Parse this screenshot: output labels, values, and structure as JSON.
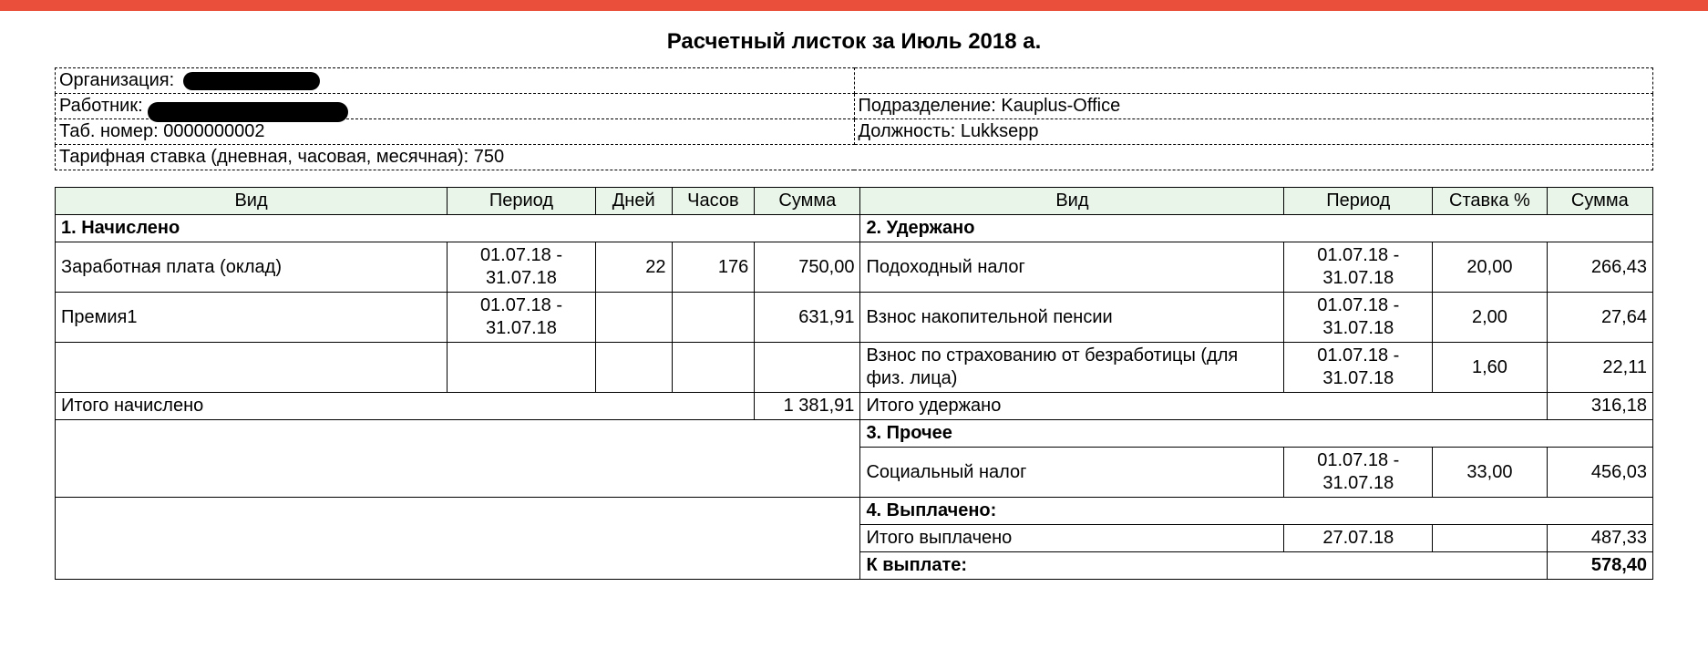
{
  "title": "Расчетный листок за Июль 2018 а.",
  "meta": {
    "org_label": "Организация:",
    "worker_label": "Работник:",
    "tabno_label": "Таб. номер:",
    "tabno_value": "0000000002",
    "dept_label": "Подразделение:",
    "dept_value": "Kauplus-Office",
    "pos_label": "Должность:",
    "pos_value": "Lukksepp",
    "rate_label": "Тарифная ставка (дневная, часовая, месячная):",
    "rate_value": "750"
  },
  "headers": {
    "vid": "Вид",
    "period": "Период",
    "days": "Дней",
    "hours": "Часов",
    "sum": "Сумма",
    "rate": "Ставка %"
  },
  "sections": {
    "accrued": "1. Начислено",
    "withheld": "2. Удержано",
    "other": "3. Прочее",
    "paid": "4. Выплачено:",
    "accrued_total": "Итого начислено",
    "withheld_total": "Итого удержано",
    "paid_total": "Итого выплачено",
    "to_pay": "К выплате:"
  },
  "accrued": [
    {
      "name": "Заработная плата (оклад)",
      "period": "01.07.18 - 31.07.18",
      "days": "22",
      "hours": "176",
      "sum": "750,00"
    },
    {
      "name": "Премия1",
      "period": "01.07.18 - 31.07.18",
      "days": "",
      "hours": "",
      "sum": "631,91"
    }
  ],
  "accrued_total_sum": "1 381,91",
  "withheld": [
    {
      "name": "Подоходный налог",
      "period": "01.07.18 - 31.07.18",
      "rate": "20,00",
      "sum": "266,43"
    },
    {
      "name": "Взнос накопительной пенсии",
      "period": "01.07.18 - 31.07.18",
      "rate": "2,00",
      "sum": "27,64"
    },
    {
      "name": "Взнос по страхованию от безработицы (для физ. лица)",
      "period": "01.07.18 - 31.07.18",
      "rate": "1,60",
      "sum": "22,11"
    }
  ],
  "withheld_total_sum": "316,18",
  "other": [
    {
      "name": "Социальный налог",
      "period": "01.07.18 - 31.07.18",
      "rate": "33,00",
      "sum": "456,03"
    }
  ],
  "paid": {
    "date": "27.07.18",
    "sum": "487,33"
  },
  "to_pay_sum": "578,40"
}
